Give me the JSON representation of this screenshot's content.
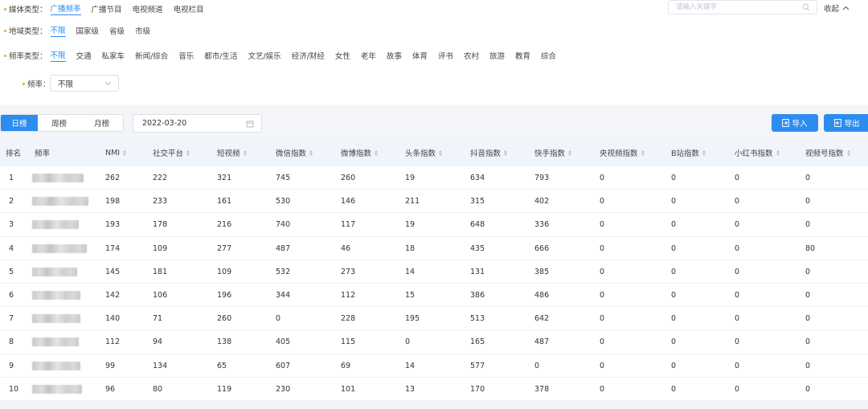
{
  "filters": {
    "media": {
      "label": "媒体类型：",
      "options": [
        "广播频率",
        "广播节目",
        "电视频道",
        "电视栏目"
      ],
      "active": 0
    },
    "region": {
      "label": "地域类型：",
      "options": [
        "不限",
        "国家级",
        "省级",
        "市级"
      ],
      "active": 0
    },
    "frequency_type": {
      "label": "频率类型：",
      "options": [
        "不限",
        "交通",
        "私家车",
        "新闻/综合",
        "音乐",
        "都市/生活",
        "文艺/娱乐",
        "经济/财经",
        "女性",
        "老年",
        "故事",
        "体育",
        "评书",
        "农村",
        "旅游",
        "教育",
        "综合"
      ],
      "active": 0
    },
    "frequency": {
      "label": "频率：",
      "value": "不限"
    }
  },
  "search": {
    "placeholder": "请输入关键字"
  },
  "collapse_label": "收起",
  "toolbar": {
    "tabs": [
      "日榜",
      "周榜",
      "月榜"
    ],
    "active_tab": 0,
    "date": "2022-03-20",
    "import_label": "导入",
    "export_label": "导出"
  },
  "table": {
    "headers": [
      "排名",
      "频率",
      "NMI",
      "社交平台",
      "短视频",
      "微信指数",
      "微博指数",
      "头条指数",
      "抖音指数",
      "快手指数",
      "央视频指数",
      "B站指数",
      "小红书指数",
      "视频号指数"
    ],
    "rows": [
      {
        "rank": "1",
        "nmi": "262",
        "social": "222",
        "short_video": "321",
        "wechat": "745",
        "weibo": "260",
        "toutiao": "19",
        "douyin": "634",
        "kuaishou": "793",
        "cctv": "0",
        "bilibili": "0",
        "xiaohongshu": "0",
        "channels": "0"
      },
      {
        "rank": "2",
        "nmi": "198",
        "social": "233",
        "short_video": "161",
        "wechat": "530",
        "weibo": "146",
        "toutiao": "211",
        "douyin": "315",
        "kuaishou": "402",
        "cctv": "0",
        "bilibili": "0",
        "xiaohongshu": "0",
        "channels": "0"
      },
      {
        "rank": "3",
        "nmi": "193",
        "social": "178",
        "short_video": "216",
        "wechat": "740",
        "weibo": "117",
        "toutiao": "19",
        "douyin": "648",
        "kuaishou": "336",
        "cctv": "0",
        "bilibili": "0",
        "xiaohongshu": "0",
        "channels": "0"
      },
      {
        "rank": "4",
        "nmi": "174",
        "social": "109",
        "short_video": "277",
        "wechat": "487",
        "weibo": "46",
        "toutiao": "18",
        "douyin": "435",
        "kuaishou": "666",
        "cctv": "0",
        "bilibili": "0",
        "xiaohongshu": "0",
        "channels": "80"
      },
      {
        "rank": "5",
        "nmi": "145",
        "social": "181",
        "short_video": "109",
        "wechat": "532",
        "weibo": "273",
        "toutiao": "14",
        "douyin": "131",
        "kuaishou": "385",
        "cctv": "0",
        "bilibili": "0",
        "xiaohongshu": "0",
        "channels": "0"
      },
      {
        "rank": "6",
        "nmi": "142",
        "social": "106",
        "short_video": "196",
        "wechat": "344",
        "weibo": "112",
        "toutiao": "15",
        "douyin": "386",
        "kuaishou": "486",
        "cctv": "0",
        "bilibili": "0",
        "xiaohongshu": "0",
        "channels": "0"
      },
      {
        "rank": "7",
        "nmi": "140",
        "social": "71",
        "short_video": "260",
        "wechat": "0",
        "weibo": "228",
        "toutiao": "195",
        "douyin": "513",
        "kuaishou": "642",
        "cctv": "0",
        "bilibili": "0",
        "xiaohongshu": "0",
        "channels": "0"
      },
      {
        "rank": "8",
        "nmi": "112",
        "social": "94",
        "short_video": "138",
        "wechat": "405",
        "weibo": "115",
        "toutiao": "0",
        "douyin": "165",
        "kuaishou": "487",
        "cctv": "0",
        "bilibili": "0",
        "xiaohongshu": "0",
        "channels": "0"
      },
      {
        "rank": "9",
        "nmi": "99",
        "social": "134",
        "short_video": "65",
        "wechat": "607",
        "weibo": "69",
        "toutiao": "14",
        "douyin": "577",
        "kuaishou": "0",
        "cctv": "0",
        "bilibili": "0",
        "xiaohongshu": "0",
        "channels": "0"
      },
      {
        "rank": "10",
        "nmi": "96",
        "social": "80",
        "short_video": "119",
        "wechat": "230",
        "weibo": "101",
        "toutiao": "13",
        "douyin": "170",
        "kuaishou": "378",
        "cctv": "0",
        "bilibili": "0",
        "xiaohongshu": "0",
        "channels": "0"
      }
    ]
  },
  "colors": {
    "accent": "#2d8cf0",
    "dot": "#f5a524",
    "header_bg": "#f0f5fb",
    "page_bg": "#f3f5f9"
  },
  "icons": [
    "search-icon",
    "chevron-up-icon",
    "chevron-down-icon",
    "calendar-icon",
    "import-icon",
    "export-icon"
  ]
}
